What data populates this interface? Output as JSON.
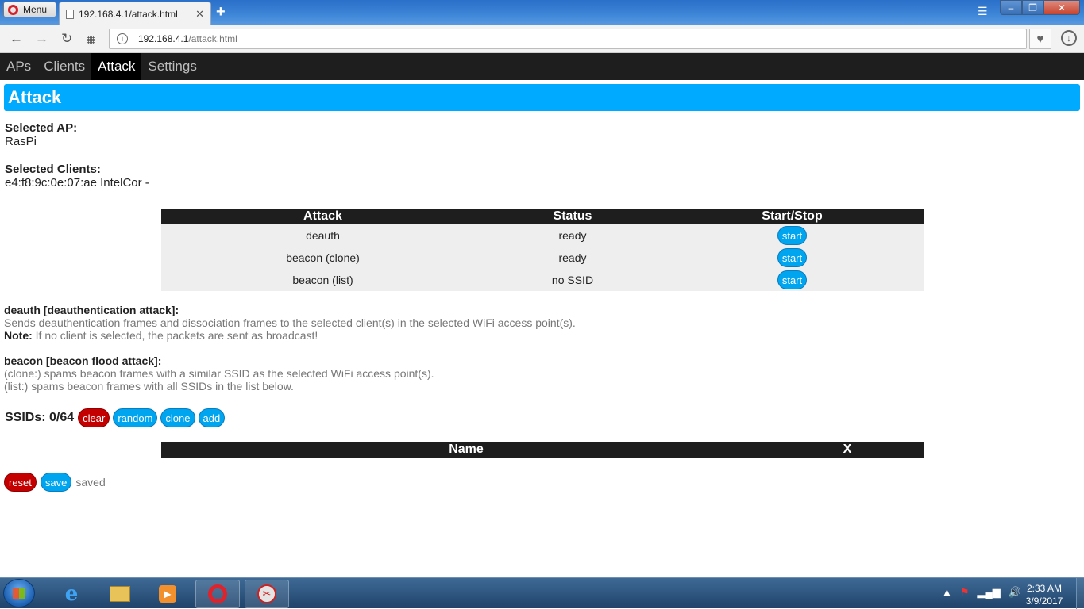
{
  "browser": {
    "menu_label": "Menu",
    "tab_title": "192.168.4.1/attack.html",
    "new_tab": "+",
    "url_host": "192.168.4.1",
    "url_path": "/attack.html",
    "site_icon": "i",
    "win_min": "–",
    "win_max": "❐",
    "win_close": "✕"
  },
  "nav": {
    "items": [
      {
        "label": "APs",
        "active": false
      },
      {
        "label": "Clients",
        "active": false
      },
      {
        "label": "Attack",
        "active": true
      },
      {
        "label": "Settings",
        "active": false
      }
    ]
  },
  "header": {
    "title": "Attack"
  },
  "selected_ap": {
    "label": "Selected AP:",
    "value": "RasPi"
  },
  "selected_clients": {
    "label": "Selected Clients:",
    "value": "e4:f8:9c:0e:07:ae IntelCor -"
  },
  "attack_table": {
    "headers": [
      "Attack",
      "Status",
      "Start/Stop"
    ],
    "rows": [
      {
        "attack": "deauth",
        "status": "ready",
        "button": "start"
      },
      {
        "attack": "beacon (clone)",
        "status": "ready",
        "button": "start"
      },
      {
        "attack": "beacon (list)",
        "status": "no SSID",
        "button": "start"
      }
    ]
  },
  "info": {
    "deauth_title": "deauth [deauthentication attack]:",
    "deauth_desc": "Sends deauthentication frames and dissociation frames to the selected client(s) in the selected WiFi access point(s).",
    "note_label": "Note:",
    "note_text": " If no client is selected, the packets are sent as broadcast!",
    "beacon_title": "beacon [beacon flood attack]:",
    "beacon_clone": "(clone:) spams beacon frames with a similar SSID as the selected WiFi access point(s).",
    "beacon_list": "(list:) spams beacon frames with all SSIDs in the list below."
  },
  "ssids": {
    "label": "SSIDs: 0/64",
    "buttons": {
      "clear": "clear",
      "random": "random",
      "clone": "clone",
      "add": "add"
    }
  },
  "name_table": {
    "headers": [
      "Name",
      "X"
    ]
  },
  "footer": {
    "reset": "reset",
    "save": "save",
    "status": "saved"
  },
  "taskbar": {
    "time": "2:33 AM",
    "date": "3/9/2017"
  },
  "colors": {
    "accent": "#00aaff",
    "danger": "#c40000",
    "ready": "#22b422",
    "nav_bg": "#1e1e1e"
  }
}
